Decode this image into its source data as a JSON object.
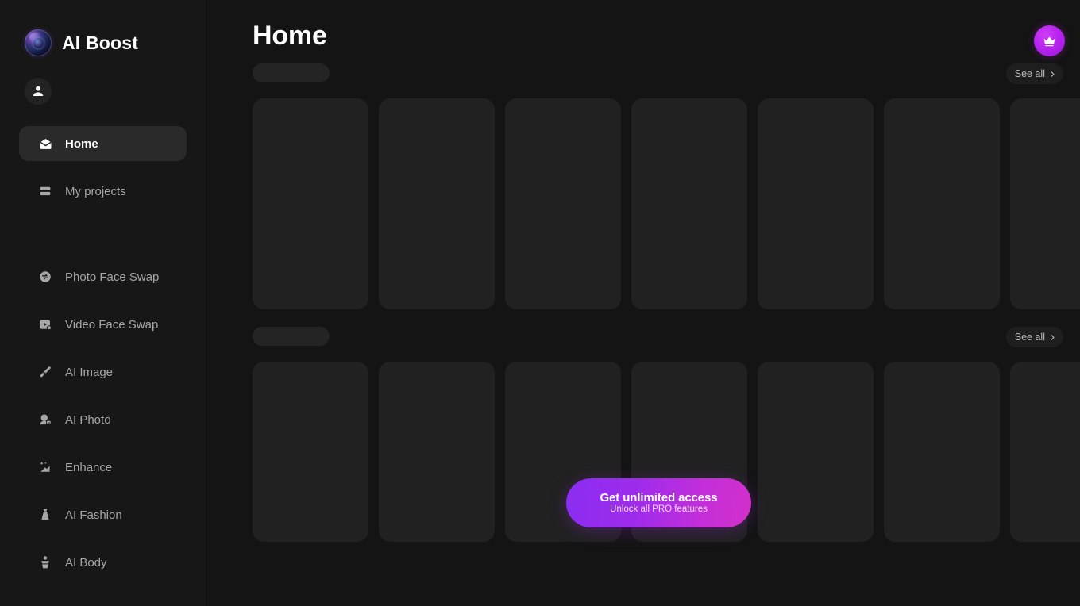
{
  "app": {
    "brand_name": "AI Boost",
    "logo_icon": "lens-orb-icon",
    "accent_purple": "#8a2df2",
    "accent_magenta": "#d22fca",
    "sidebar_bg": "#171717",
    "main_bg": "#141414",
    "card_bg": "#212121"
  },
  "sidebar": {
    "avatar_icon": "user-avatar-icon",
    "primary_items": [
      {
        "id": "home",
        "label": "Home",
        "icon": "home-icon",
        "active": true
      },
      {
        "id": "my-projects",
        "label": "My projects",
        "icon": "layers-icon",
        "active": false
      }
    ],
    "tool_items": [
      {
        "id": "photo-face-swap",
        "label": "Photo Face Swap",
        "icon": "face-swap-icon"
      },
      {
        "id": "video-face-swap",
        "label": "Video Face Swap",
        "icon": "video-swap-icon"
      },
      {
        "id": "ai-image",
        "label": "AI Image",
        "icon": "paintbrush-icon"
      },
      {
        "id": "ai-photo",
        "label": "AI Photo",
        "icon": "portrait-ai-icon"
      },
      {
        "id": "enhance",
        "label": "Enhance",
        "icon": "image-sparkle-icon"
      },
      {
        "id": "ai-fashion",
        "label": "AI Fashion",
        "icon": "dress-icon"
      },
      {
        "id": "ai-body",
        "label": "AI Body",
        "icon": "body-icon"
      }
    ]
  },
  "header": {
    "title": "Home",
    "pro_button_icon": "crown-icon",
    "pro_button_label": ""
  },
  "sections": [
    {
      "id": "section-1",
      "title_placeholder": "",
      "see_all_label": "See all",
      "see_all_icon": "chevron-right-icon",
      "cards": [
        {
          "id": "card-1-1"
        },
        {
          "id": "card-1-2"
        },
        {
          "id": "card-1-3"
        },
        {
          "id": "card-1-4"
        },
        {
          "id": "card-1-5"
        },
        {
          "id": "card-1-6"
        },
        {
          "id": "card-1-7"
        },
        {
          "id": "card-1-8"
        }
      ]
    },
    {
      "id": "section-2",
      "title_placeholder": "",
      "see_all_label": "See all",
      "see_all_icon": "chevron-right-icon",
      "cards": [
        {
          "id": "card-2-1"
        },
        {
          "id": "card-2-2"
        },
        {
          "id": "card-2-3"
        },
        {
          "id": "card-2-4"
        },
        {
          "id": "card-2-5"
        },
        {
          "id": "card-2-6"
        },
        {
          "id": "card-2-7"
        },
        {
          "id": "card-2-8"
        }
      ]
    }
  ],
  "cta": {
    "title": "Get unlimited access",
    "subtitle": "Unlock all PRO features"
  }
}
